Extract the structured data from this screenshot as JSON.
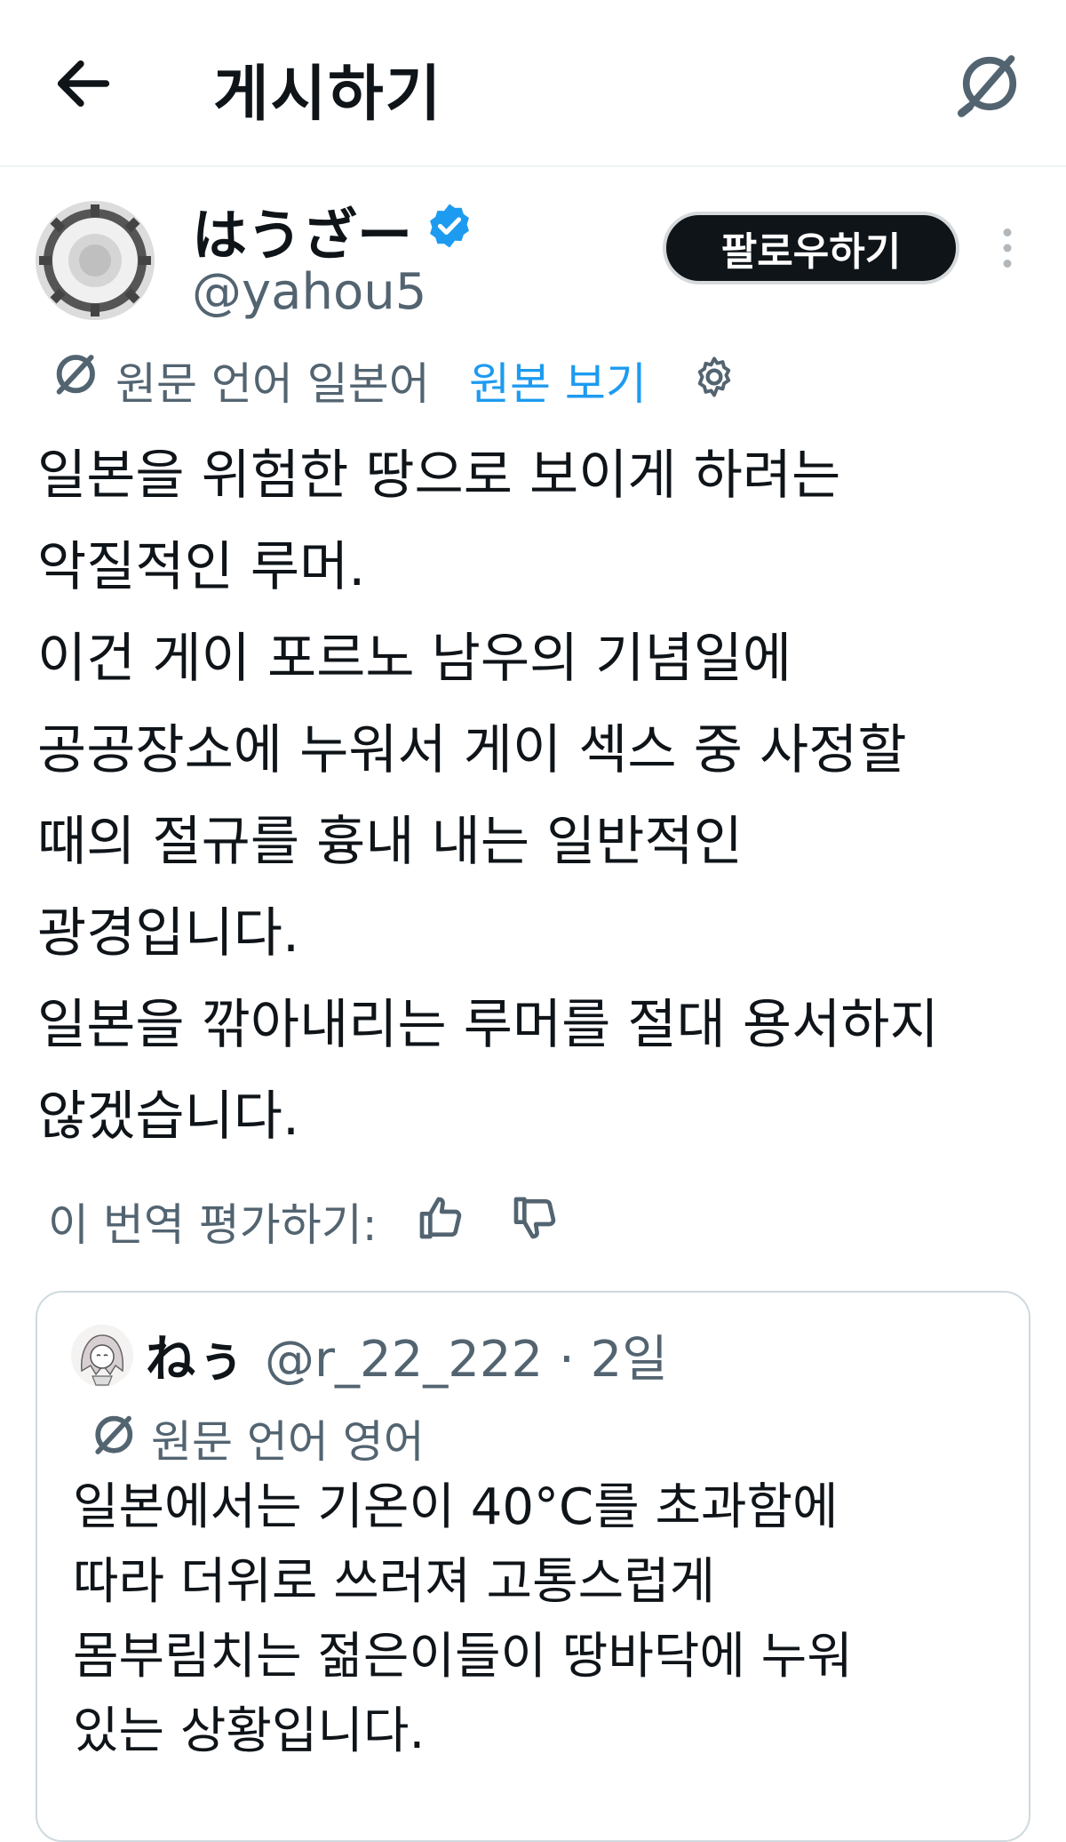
{
  "header": {
    "title": "게시하기",
    "back_icon": "arrow-left-icon",
    "translate_icon": "translate-icon"
  },
  "author": {
    "display_name": "はうざー",
    "handle": "@yahou5",
    "verified_color": "#1d9bf0",
    "follow_label": "팔로우하기"
  },
  "translation": {
    "label": "원문 언어 일본어",
    "show_original": "원본 보기"
  },
  "post": {
    "lines": [
      "일본을 위험한 땅으로 보이게 하려는",
      "악질적인 루머.",
      "이건 게이 포르노 남우의 기념일에",
      "공공장소에 누워서 게이 섹스 중 사정할",
      "때의 절규를 흉내 내는 일반적인",
      "광경입니다.",
      "일본을 깎아내리는 루머를 절대 용서하지",
      "않겠습니다."
    ]
  },
  "rate": {
    "label": "이 번역 평가하기:"
  },
  "quote": {
    "display_name": "ねぅ",
    "meta": "@r_22_222 · 2일",
    "translation_label": "원문 언어 영어",
    "lines": [
      "일본에서는 기온이 40°C를 초과함에",
      "따라 더위로 쓰러져 고통스럽게",
      "몸부림치는 젊은이들이 땅바닥에 누워",
      "있는 상황입니다."
    ]
  },
  "colors": {
    "text": "#0f1419",
    "secondary": "#536471",
    "link": "#1d9bf0"
  }
}
